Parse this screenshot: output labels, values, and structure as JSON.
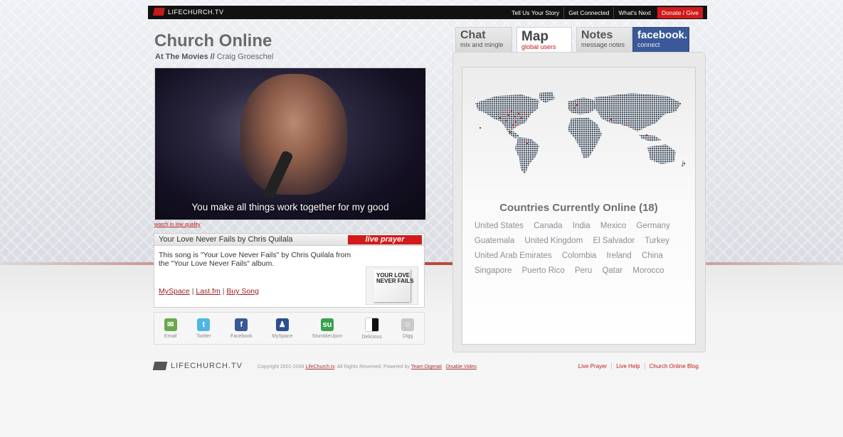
{
  "topbar": {
    "logo_text": "LIFECHURCH.TV",
    "links": [
      "Tell Us Your Story",
      "Get Connected",
      "What's Next"
    ],
    "donate": "Donate / Give"
  },
  "header": {
    "title": "Church Online",
    "series": "At The Movies //",
    "speaker": "Craig Groeschel"
  },
  "video": {
    "caption": "You make all things work together for my good",
    "low_quality_link": "watch in low quality"
  },
  "song": {
    "title": "Your Love Never Fails by Chris Quilala",
    "live_prayer": "live prayer",
    "description": "This song is \"Your Love Never Fails\" by Chris Quilala from the \"Your Love Never Fails\" album.",
    "links": [
      "MySpace",
      "Last.fm",
      "Buy Song"
    ],
    "separator": "|",
    "album_text": "YOUR LOVE NEVER FAILS"
  },
  "share": [
    {
      "label": "Email",
      "icon": "email-icon",
      "color": "#6aa84f",
      "glyph": "✉"
    },
    {
      "label": "Twitter",
      "icon": "twitter-icon",
      "color": "#4fb5e6",
      "glyph": "t"
    },
    {
      "label": "Facebook",
      "icon": "facebook-icon",
      "color": "#3b5998",
      "glyph": "f"
    },
    {
      "label": "MySpace",
      "icon": "myspace-icon",
      "color": "#2a4f8f",
      "glyph": "♟"
    },
    {
      "label": "StumbleUpon",
      "icon": "stumbleupon-icon",
      "color": "#3aa14d",
      "glyph": "su"
    },
    {
      "label": "Delicious",
      "icon": "delicious-icon",
      "color": "#3274d1",
      "glyph": ""
    },
    {
      "label": "Digg",
      "icon": "digg-icon",
      "color": "#c9c9c9",
      "glyph": "☺"
    }
  ],
  "tabs": [
    {
      "title": "Chat",
      "subtitle": "mix and mingle"
    },
    {
      "title": "Map",
      "subtitle": "global users"
    },
    {
      "title": "Notes",
      "subtitle": "message notes"
    },
    {
      "title": "facebook.",
      "subtitle": "connect"
    }
  ],
  "map_panel": {
    "countries_title": "Countries Currently Online (18)",
    "countries": [
      "United States",
      "Canada",
      "India",
      "Mexico",
      "Germany",
      "Guatemala",
      "United Kingdom",
      "El Salvador",
      "Turkey",
      "United Arab Emirates",
      "Colombia",
      "Ireland",
      "China",
      "Singapore",
      "Puerto Rico",
      "Peru",
      "Qatar",
      "Morocco"
    ]
  },
  "footer": {
    "logo_text": "LIFECHURCH.TV",
    "copyright_prefix": "Copyright 2001-2009",
    "copyright_link": "LifeChurch.tv",
    "copyright_mid": ". All Rights Reserved. Powered by",
    "powered_link": "Team Digerati",
    "disable_video": "Disable Video",
    "links": [
      "Live Prayer",
      "Live Help",
      "Church Online Blog"
    ]
  },
  "colors": {
    "accent_red": "#d11b1b",
    "facebook_blue": "#3b5998",
    "map_dots": "#4c5a6a"
  }
}
